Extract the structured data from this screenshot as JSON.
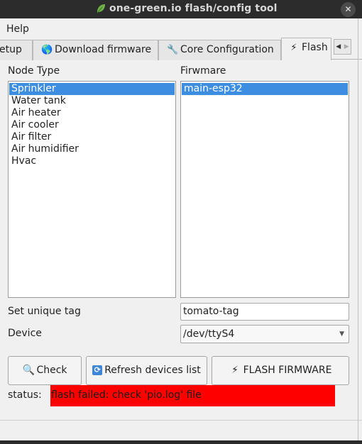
{
  "window": {
    "title": "one-green.io flash/config tool",
    "close_glyph": "✕"
  },
  "menubar": {
    "items": [
      "Help"
    ]
  },
  "tabs": [
    {
      "label": "etup",
      "icon": ""
    },
    {
      "label": "Download firmware",
      "icon": "globe-icon"
    },
    {
      "label": "Core Configuration",
      "icon": "wrench-icon"
    },
    {
      "label": "Flash",
      "icon": "lightning-icon",
      "active": true
    }
  ],
  "tab_scroll": {
    "left": "◀",
    "right": "▶"
  },
  "node_type": {
    "heading": "Node Type",
    "items": [
      "Sprinkler",
      "Water tank",
      "Air heater",
      "Air cooler",
      "Air filter",
      "Air humidifier",
      "Hvac"
    ],
    "selected_index": 0
  },
  "firmware": {
    "heading": "Firwmare",
    "items": [
      "main-esp32"
    ],
    "selected_index": 0
  },
  "unique_tag": {
    "label": "Set unique tag",
    "value": "tomato-tag"
  },
  "device": {
    "label": "Device",
    "selected": "/dev/ttyS4",
    "chevron": "▼"
  },
  "buttons": {
    "check": {
      "label": "Check",
      "icon": "magnifier-icon",
      "glyph": "🔍"
    },
    "refresh": {
      "label": "Refresh devices list",
      "icon": "refresh-icon",
      "glyph": "⟳"
    },
    "flash": {
      "label": "FLASH FIRMWARE",
      "icon": "lightning-icon",
      "glyph": "⚡"
    }
  },
  "status": {
    "label": "status:",
    "message": "flash failed: check 'pio.log' file",
    "color": "#ff0000"
  },
  "colors": {
    "selection": "#3d8ee0",
    "titlebar": "#2c2c2c",
    "window_bg": "#f0f0f0"
  }
}
